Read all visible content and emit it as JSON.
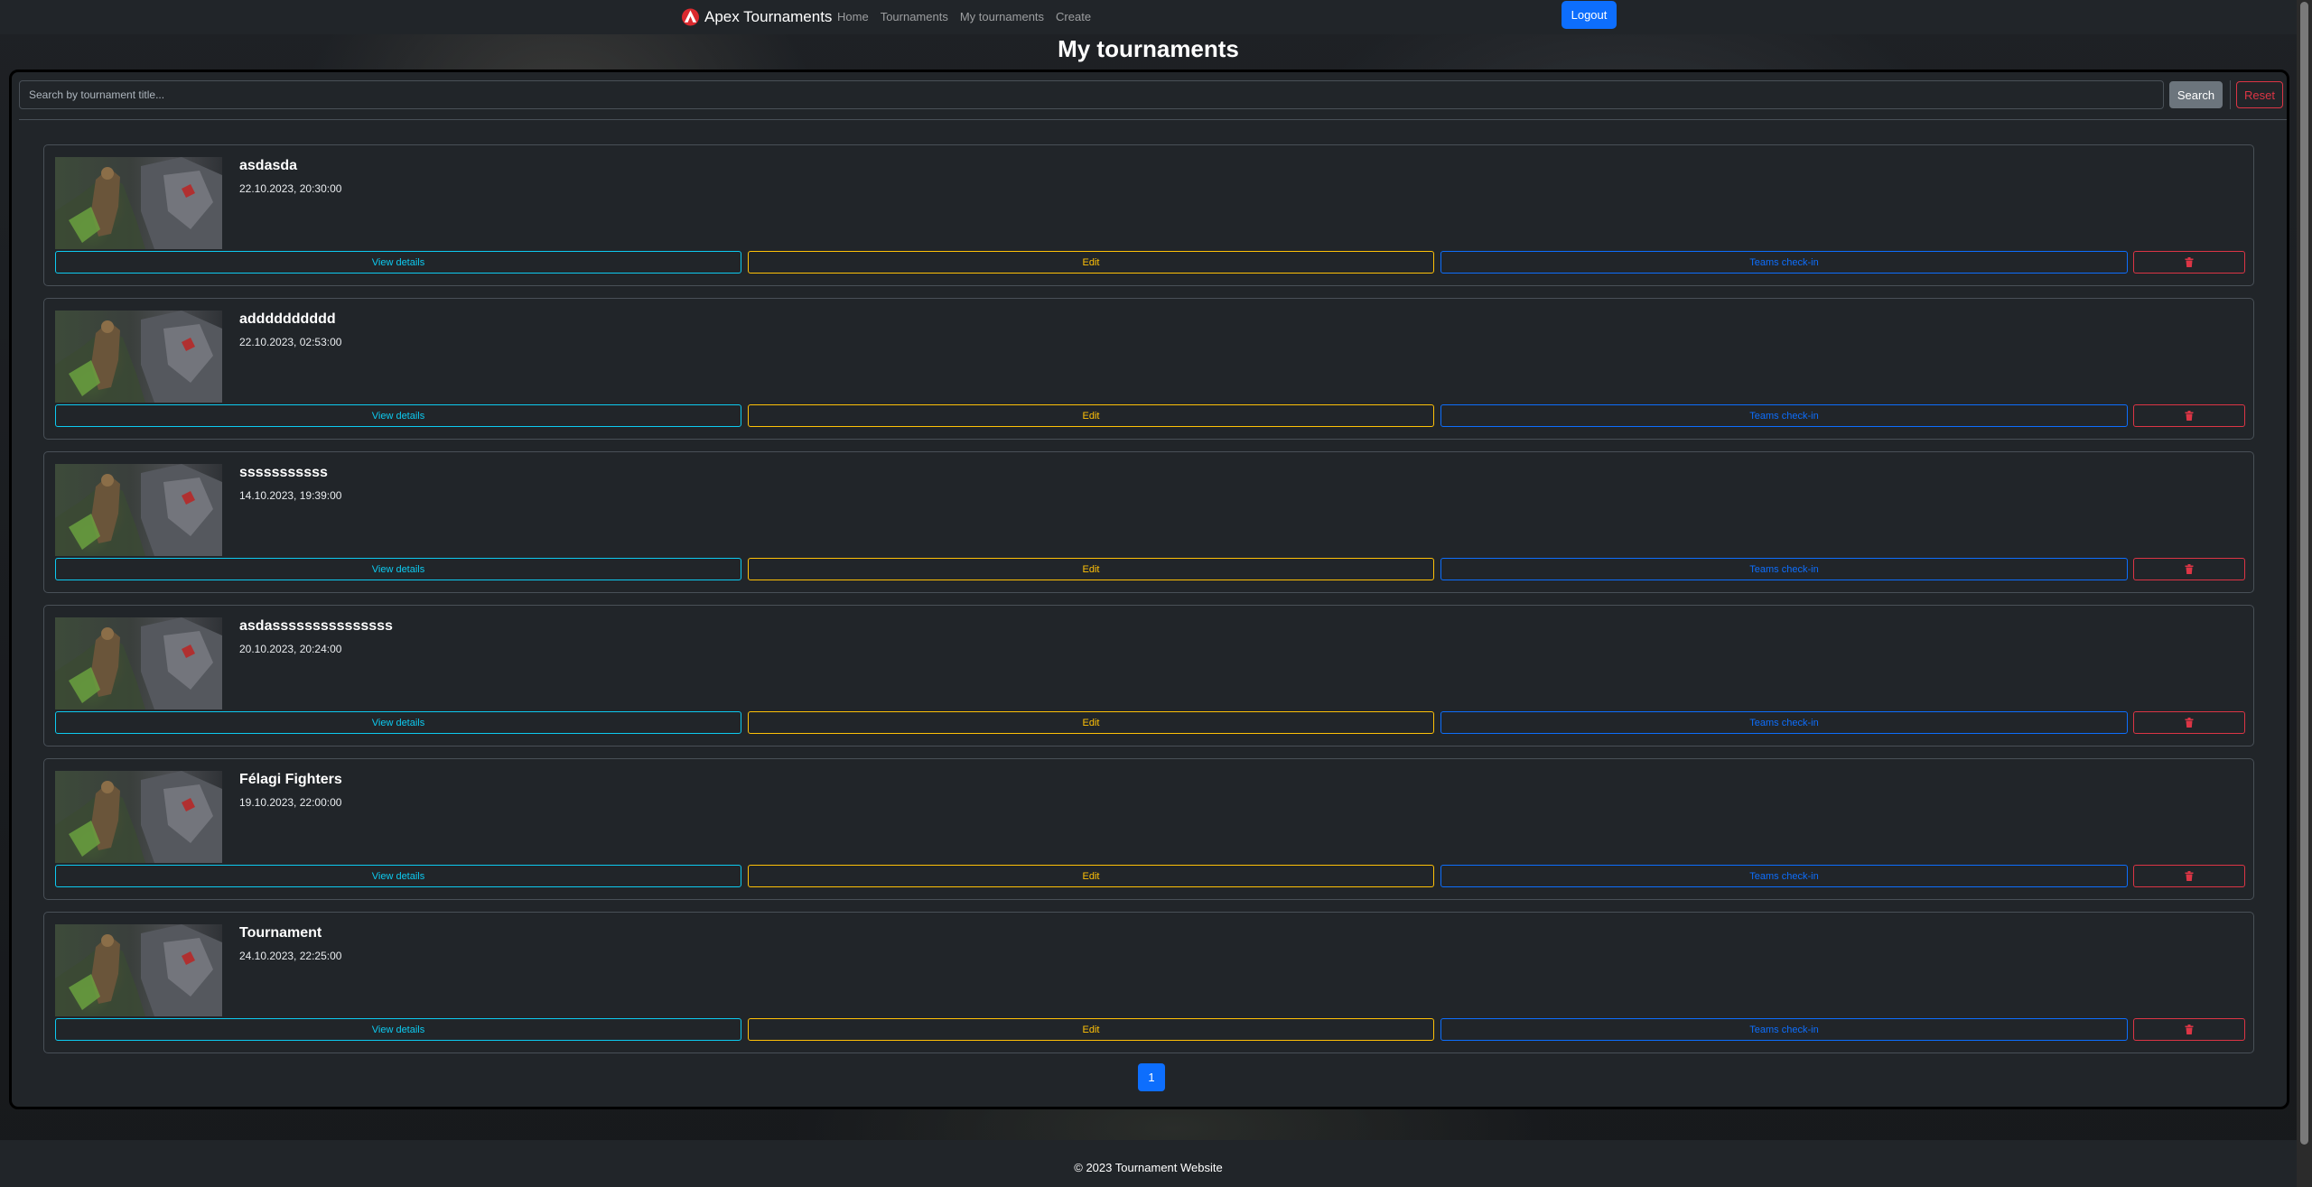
{
  "navbar": {
    "brand": "Apex Tournaments",
    "links": [
      "Home",
      "Tournaments",
      "My tournaments",
      "Create"
    ],
    "logout_label": "Logout"
  },
  "page": {
    "title": "My tournaments"
  },
  "search": {
    "placeholder": "Search by tournament title...",
    "search_label": "Search",
    "reset_label": "Reset"
  },
  "tournaments": [
    {
      "title": "asdasda",
      "date": "22.10.2023, 20:30:00"
    },
    {
      "title": "adddddddddd",
      "date": "22.10.2023, 02:53:00"
    },
    {
      "title": "sssssssssss",
      "date": "14.10.2023, 19:39:00"
    },
    {
      "title": "asdasssssssssssssss",
      "date": "20.10.2023, 20:24:00"
    },
    {
      "title": "Félagi Fighters",
      "date": "19.10.2023, 22:00:00"
    },
    {
      "title": "Tournament",
      "date": "24.10.2023, 22:25:00"
    }
  ],
  "card_actions": {
    "view_label": "View details",
    "edit_label": "Edit",
    "teams_label": "Teams check-in",
    "delete_icon": "trash-icon"
  },
  "pagination": {
    "current_page": "1"
  },
  "footer": {
    "text": "© 2023 Tournament Website"
  },
  "colors": {
    "primary": "#0d6efd",
    "info": "#0dcaf0",
    "warning": "#ffc107",
    "danger": "#dc3545",
    "secondary": "#6c757d",
    "surface": "#212529"
  }
}
